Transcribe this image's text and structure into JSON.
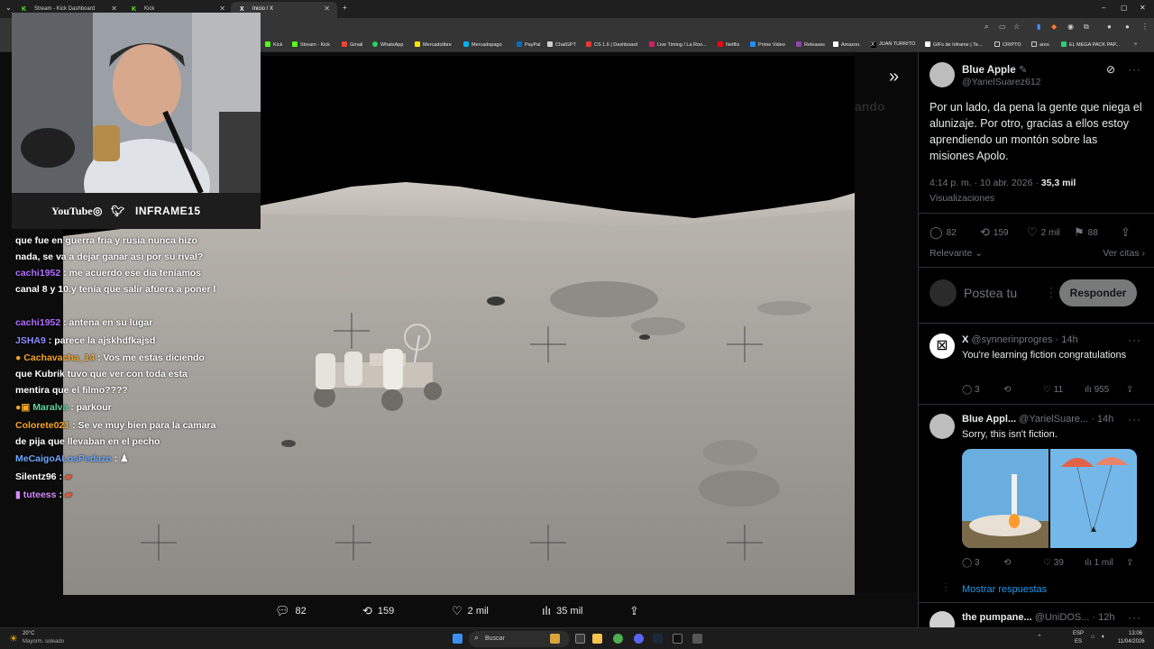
{
  "browser": {
    "tabs": [
      {
        "label": "Stream - Kick Dashboard"
      },
      {
        "label": "Kick"
      },
      {
        "label": "Inicio / X"
      }
    ],
    "bookmarks": [
      "Kick",
      "Stream - Kick",
      "Gmail",
      "WhatsApp",
      "Mercadolibre",
      "Mercadopago",
      "PayPal",
      "ChatGPT",
      "CS 1.6 | Dashboard",
      "Live Timing / La Ron...",
      "Netflix",
      "Prime Video",
      "Releases",
      "Amazon.",
      "JUAN TURRITO",
      "GIFs de Inframe | Te...",
      "CRIPTO",
      "ares",
      "EL MEGA PACK PAP..."
    ]
  },
  "stream": {
    "brand_youtube": "YouTube",
    "brand_name": "INFRAME15"
  },
  "chat": [
    {
      "user": "",
      "text": "que fue en guerra fria y rusia nunca hizo nada, se va a dejar ganar asi por su rival?",
      "color": "#ffffff"
    },
    {
      "user": "cachi1952",
      "text": ": me acuerdo ese dia teníamos canal 8 y 10.y tenía que salir afuera a poner l",
      "color": "#b36dff"
    },
    {
      "user": "cachi1952",
      "text": ": antena en su lugar",
      "color": "#b36dff"
    },
    {
      "user": "JSHA9",
      "text": ": parece la ajskhdfkajsd",
      "color": "#8c8cff"
    },
    {
      "user": "Cachavacha_14",
      "text": ": Vos me estas diciendo que Kubrik tuvo que ver con toda esta mentira que el filmo????",
      "color": "#f5a623"
    },
    {
      "user": "Maralva",
      "text": ": parkour",
      "color": "#5cd6a5"
    },
    {
      "user": "Colorete021",
      "text": ": Se ve muy bien para la camara de pija que llevaban en el pecho",
      "color": "#f5a623"
    },
    {
      "user": "MeCaigoALosPedazo",
      "text": ":",
      "color": "#6fa8ff"
    },
    {
      "user": "Silentz96",
      "text": ":",
      "color": "#ffffff"
    },
    {
      "user": "tuteess",
      "text": ":",
      "color": "#d889ff"
    }
  ],
  "post_actions": {
    "replies": "82",
    "reposts": "159",
    "likes": "2 mil",
    "views": "35 mil"
  },
  "panel": {
    "author_name": "Blue Apple",
    "author_handle": "@YarielSuarez612",
    "text": "Por un lado, da pena la gente que niega el alunizaje. Por otro, gracias a ellos estoy aprendiendo un montón sobre las misiones Apolo.",
    "meta_time": "4:14 p. m. · 10 abr. 2026 ·",
    "meta_views": "35,3 mil",
    "meta_views_label": "Visualizaciones",
    "stats": {
      "replies": "82",
      "reposts": "159",
      "likes": "2 mil",
      "bookmarks": "88"
    },
    "sort_label": "Relevante",
    "quotes_label": "Ver citas",
    "reply_placeholder": "Postea tu",
    "reply_button": "Responder",
    "replies": [
      {
        "name": "X",
        "handle": "@synnerinprogres · 14h",
        "text": "You're learning fiction congratulations",
        "replies": "3",
        "likes": "11",
        "views": "955"
      },
      {
        "name": "Blue Appl...",
        "handle": "@YarielSuare... · 14h",
        "text": "Sorry, this isn't fiction.",
        "replies": "3",
        "likes": "39",
        "views": "1 mil"
      },
      {
        "name": "the pumpane...",
        "handle": "@UniDOS... · 12h",
        "text": "",
        "replies": "",
        "likes": "",
        "views": ""
      }
    ],
    "show_more": "Mostrar respuestas"
  },
  "taskbar": {
    "weather_temp": "20°C",
    "weather_desc": "Mayorm. soleado",
    "search_label": "Buscar",
    "lang1": "ESP",
    "lang2": "ES",
    "time": "13:06",
    "date": "11/04/2026"
  }
}
